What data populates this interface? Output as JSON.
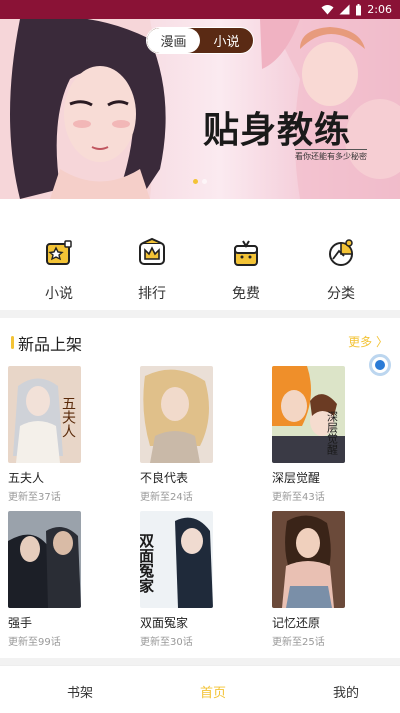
{
  "status_bar": {
    "time": "2:06",
    "icons": [
      "wifi-icon",
      "signal-icon",
      "battery-icon"
    ]
  },
  "banner": {
    "title": "贴身教练",
    "subtitle": "看你还能有多少秘密",
    "segments": [
      {
        "label": "漫画",
        "active": true
      },
      {
        "label": "小说",
        "active": false
      }
    ],
    "page_dots": 2
  },
  "quick_nav": [
    {
      "label": "小说",
      "icon": "book-star-icon"
    },
    {
      "label": "排行",
      "icon": "crown-icon"
    },
    {
      "label": "免费",
      "icon": "gift-box-icon"
    },
    {
      "label": "分类",
      "icon": "category-icon"
    }
  ],
  "new_section": {
    "title": "新品上架",
    "more": "更多 〉",
    "books": [
      {
        "title": "五夫人",
        "status": "更新至37话",
        "cover_text": "五夫人"
      },
      {
        "title": "不良代表",
        "status": "更新至24话",
        "cover_text": ""
      },
      {
        "title": "深层觉醒",
        "status": "更新至43话",
        "cover_text": "深层觉醒"
      },
      {
        "title": "强手",
        "status": "更新至99话",
        "cover_text": ""
      },
      {
        "title": "双面冤家",
        "status": "更新至30话",
        "cover_text": "双面冤家"
      },
      {
        "title": "记忆还原",
        "status": "更新至25话",
        "cover_text": ""
      }
    ]
  },
  "tabbar": [
    {
      "label": "书架",
      "active": false
    },
    {
      "label": "首页",
      "active": true
    },
    {
      "label": "我的",
      "active": false
    }
  ],
  "colors": {
    "accent": "#f3c336",
    "status_bar": "#8a1236"
  }
}
